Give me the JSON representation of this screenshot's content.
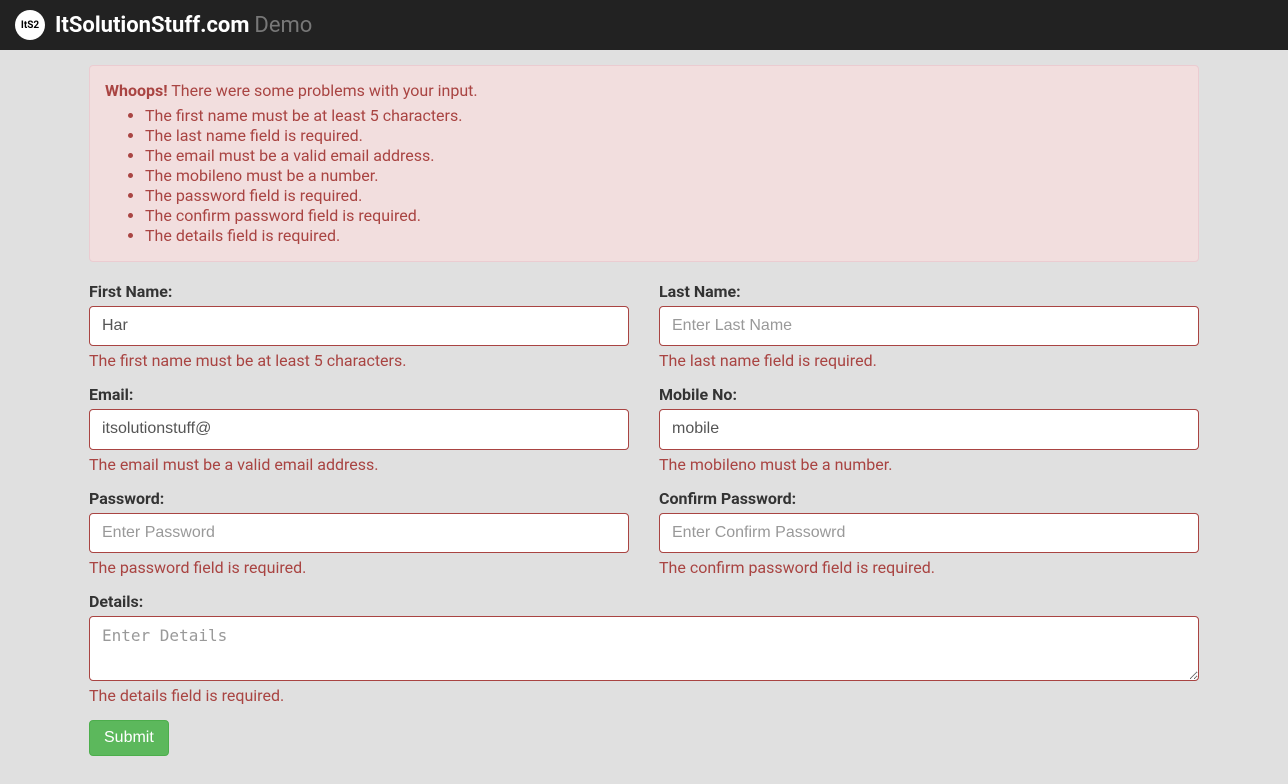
{
  "navbar": {
    "logo_text": "ItS2",
    "brand": "ItSolutionStuff.com",
    "demo_label": "Demo"
  },
  "alert": {
    "heading": "Whoops!",
    "message": "There were some problems with your input.",
    "errors": [
      "The first name must be at least 5 characters.",
      "The last name field is required.",
      "The email must be a valid email address.",
      "The mobileno must be a number.",
      "The password field is required.",
      "The confirm password field is required.",
      "The details field is required."
    ]
  },
  "form": {
    "first_name": {
      "label": "First Name:",
      "value": "Har",
      "placeholder": "",
      "error": "The first name must be at least 5 characters."
    },
    "last_name": {
      "label": "Last Name:",
      "value": "",
      "placeholder": "Enter Last Name",
      "error": "The last name field is required."
    },
    "email": {
      "label": "Email:",
      "value": "itsolutionstuff@",
      "placeholder": "",
      "error": "The email must be a valid email address."
    },
    "mobile": {
      "label": "Mobile No:",
      "value": "mobile",
      "placeholder": "",
      "error": "The mobileno must be a number."
    },
    "password": {
      "label": "Password:",
      "value": "",
      "placeholder": "Enter Password",
      "error": "The password field is required."
    },
    "confirm_password": {
      "label": "Confirm Password:",
      "value": "",
      "placeholder": "Enter Confirm Passowrd",
      "error": "The confirm password field is required."
    },
    "details": {
      "label": "Details:",
      "value": "",
      "placeholder": "Enter Details",
      "error": "The details field is required."
    },
    "submit_label": "Submit"
  }
}
